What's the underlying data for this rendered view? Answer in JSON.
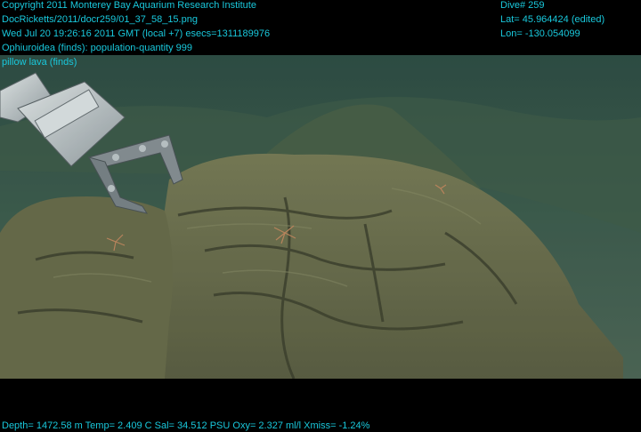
{
  "header": {
    "copyright": "Copyright 2011 Monterey Bay Aquarium Research Institute",
    "file": "DocRicketts/2011/docr259/01_37_58_15.png",
    "datetime": "Wed Jul 20 19:26:16 2011 GMT (local +7)  esecs=1311189976",
    "annotation": "Ophiuroidea (finds): population-quantity 999",
    "annotation2": "pillow lava (finds)"
  },
  "position": {
    "dive": "Dive# 259",
    "lat": "Lat= 45.964424 (edited)",
    "lon": "Lon= -130.054099"
  },
  "footer": {
    "sensors": "Depth= 1472.58 m  Temp= 2.409 C  Sal= 34.512 PSU  Oxy= 2.327 ml/l  Xmiss= -1.24%"
  },
  "colors": {
    "overlay_text": "#19c8dc",
    "water": "#2d4a40",
    "rock": "#6b6b4a"
  }
}
